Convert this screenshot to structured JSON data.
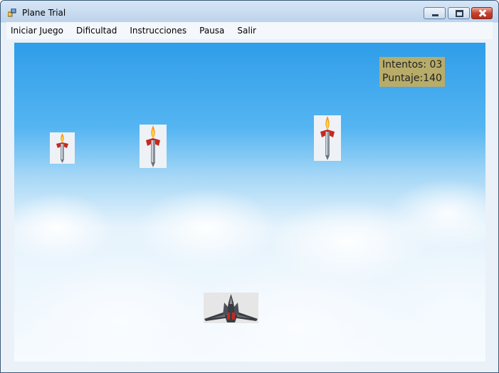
{
  "window": {
    "title": "Plane Trial"
  },
  "menu": {
    "items": [
      "Iniciar Juego",
      "Dificultad",
      "Instrucciones",
      "Pausa",
      "Salir"
    ]
  },
  "hud": {
    "intentos_label": "Intentos: 03",
    "puntaje_label": "Puntaje:140"
  },
  "game": {
    "missile_count": 3,
    "colors": {
      "sky_top": "#2f9de9",
      "hud_background": "#b8ac6a",
      "flame": "#f39a1a",
      "fin": "#c8281e"
    },
    "icons": [
      "missile-icon",
      "fighter-jet-icon"
    ]
  }
}
